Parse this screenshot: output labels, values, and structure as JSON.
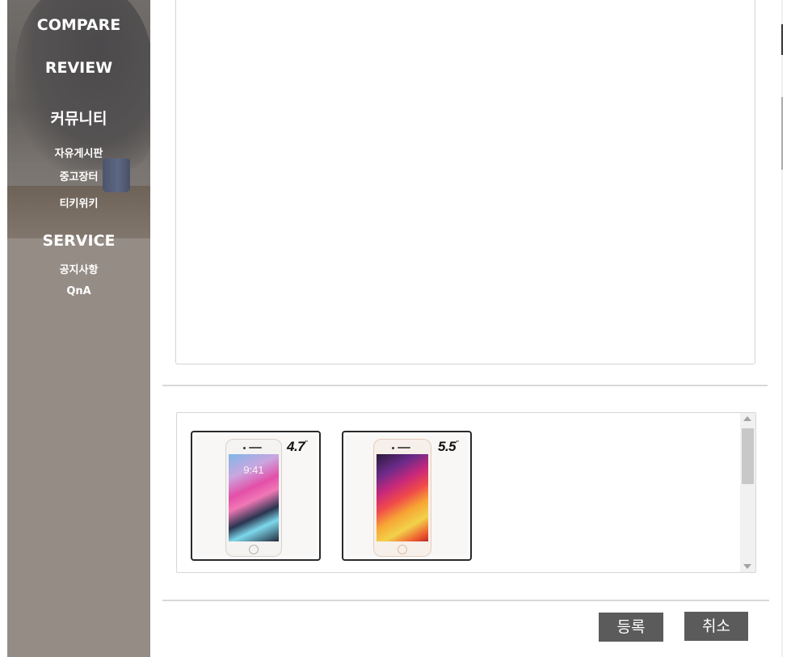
{
  "sidebar": {
    "menu": [
      {
        "label": "COMPARE",
        "kind": "main"
      },
      {
        "label": "REVIEW",
        "kind": "main"
      },
      {
        "label": "커뮤니티",
        "kind": "main"
      },
      {
        "label": "자유게시판",
        "kind": "sub"
      },
      {
        "label": "중고장터",
        "kind": "sub"
      },
      {
        "label": "티키위키",
        "kind": "sub"
      },
      {
        "label": "SERVICE",
        "kind": "main"
      },
      {
        "label": "공지사항",
        "kind": "sub"
      },
      {
        "label": "QnA",
        "kind": "sub"
      }
    ]
  },
  "attachments": {
    "images": [
      {
        "size_label": "4.7",
        "inch_mark": "\"",
        "phone_color": "silver",
        "screen_time": "9:41"
      },
      {
        "size_label": "5.5",
        "inch_mark": "\"",
        "phone_color": "gold"
      }
    ]
  },
  "actions": {
    "submit_label": "등록",
    "cancel_label": "취소"
  },
  "colors": {
    "sidebar_bg": "#958c86",
    "button_bg": "#5b5b5b",
    "button_text": "#ffffff",
    "divider": "#d8d8d8"
  },
  "icons": [
    "scroll-up-arrow-icon",
    "scroll-down-arrow-icon"
  ]
}
